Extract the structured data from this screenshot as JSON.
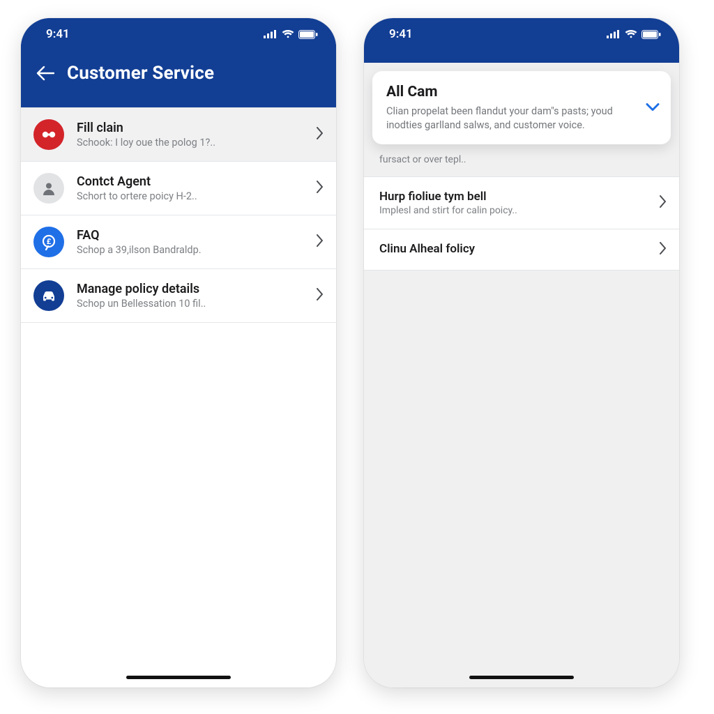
{
  "status": {
    "time": "9:41"
  },
  "phoneA": {
    "header": {
      "title": "Customer Service"
    },
    "items": [
      {
        "title": "Fill clain",
        "sub": "Schook: I loy oue the polog 1?..",
        "icon": "fill-claim-icon",
        "color": "red",
        "selected": true
      },
      {
        "title": "Contct Agent",
        "sub": "Schort to ortere poicy H-2..",
        "icon": "agent-icon",
        "color": "gray",
        "selected": false
      },
      {
        "title": "FAQ",
        "sub": "Schop a 39,ilson Bandraldp.",
        "icon": "faq-icon",
        "color": "blue",
        "selected": false
      },
      {
        "title": "Manage policy details",
        "sub": "Schop un Bellessation 10 fil..",
        "icon": "car-icon",
        "color": "navy",
        "selected": false
      }
    ]
  },
  "phoneB": {
    "card": {
      "title": "All Cam",
      "desc": "Clian propelat been flandut your dam\"s pasts; youd inodties garlland salws, and customer voice."
    },
    "under_text": "fursact or over tepl..",
    "items": [
      {
        "title": "Hurp fioliue tym bell",
        "sub": "Implesl and stirt for calin poicy.."
      },
      {
        "title": "Clinu Alheal folicy",
        "sub": ""
      }
    ]
  }
}
